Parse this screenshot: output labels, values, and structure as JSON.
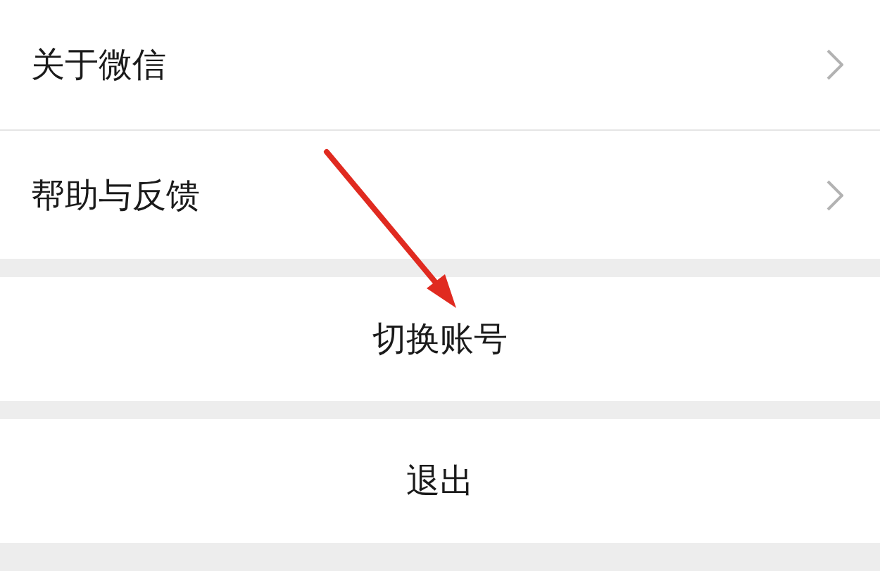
{
  "groups": [
    {
      "items": [
        {
          "kind": "nav",
          "label": "关于微信"
        },
        {
          "kind": "nav",
          "label": "帮助与反馈"
        }
      ]
    },
    {
      "items": [
        {
          "kind": "action",
          "label": "切换账号"
        }
      ]
    },
    {
      "items": [
        {
          "kind": "action",
          "label": "退出"
        }
      ]
    }
  ]
}
